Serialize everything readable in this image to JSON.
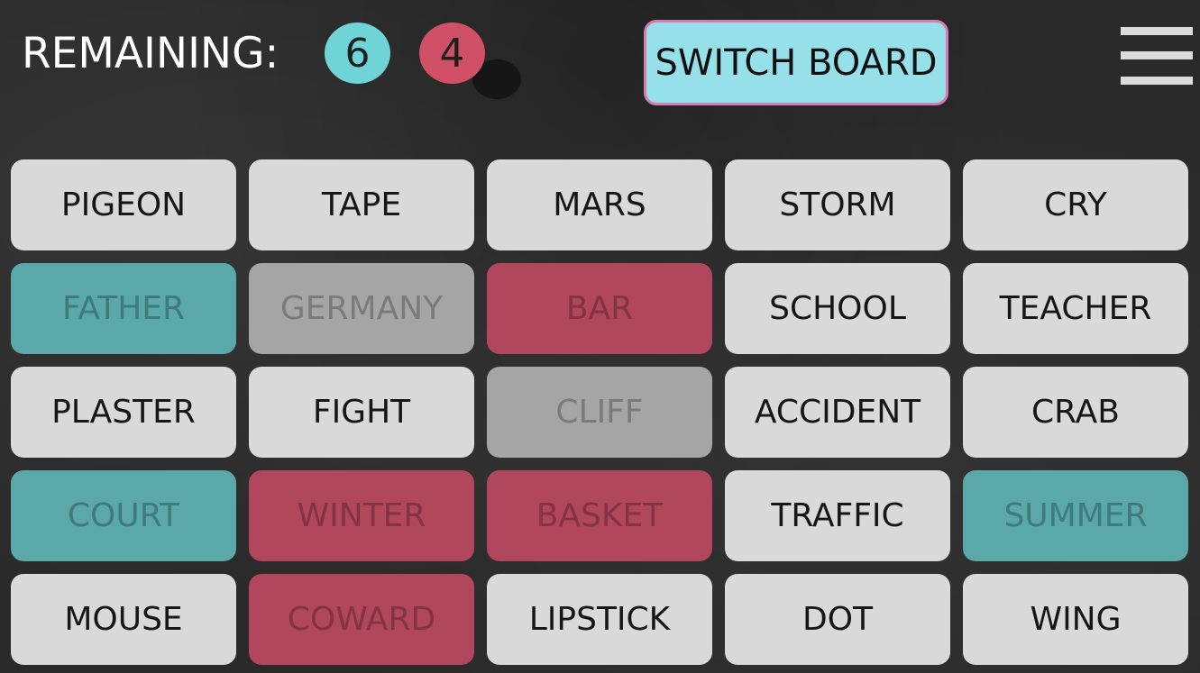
{
  "header": {
    "remaining_label": "REMAINING:",
    "teal_count": "6",
    "red_count": "4",
    "switch_board_label": "SWITCH BOARD"
  },
  "colors": {
    "teal": "#6fd4d6",
    "red": "#d05067",
    "switch_bg": "#96e0ea",
    "switch_border": "#d77bb3"
  },
  "board": {
    "cards": [
      {
        "word": "PIGEON",
        "state": "neutral"
      },
      {
        "word": "TAPE",
        "state": "neutral"
      },
      {
        "word": "MARS",
        "state": "neutral"
      },
      {
        "word": "STORM",
        "state": "neutral"
      },
      {
        "word": "CRY",
        "state": "neutral"
      },
      {
        "word": "FATHER",
        "state": "blue"
      },
      {
        "word": "GERMANY",
        "state": "bystander"
      },
      {
        "word": "BAR",
        "state": "red"
      },
      {
        "word": "SCHOOL",
        "state": "neutral"
      },
      {
        "word": "TEACHER",
        "state": "neutral"
      },
      {
        "word": "PLASTER",
        "state": "neutral"
      },
      {
        "word": "FIGHT",
        "state": "neutral"
      },
      {
        "word": "CLIFF",
        "state": "bystander"
      },
      {
        "word": "ACCIDENT",
        "state": "neutral"
      },
      {
        "word": "CRAB",
        "state": "neutral"
      },
      {
        "word": "COURT",
        "state": "blue"
      },
      {
        "word": "WINTER",
        "state": "red"
      },
      {
        "word": "BASKET",
        "state": "red"
      },
      {
        "word": "TRAFFIC",
        "state": "neutral"
      },
      {
        "word": "SUMMER",
        "state": "blue"
      },
      {
        "word": "MOUSE",
        "state": "neutral"
      },
      {
        "word": "COWARD",
        "state": "red"
      },
      {
        "word": "LIPSTICK",
        "state": "neutral"
      },
      {
        "word": "DOT",
        "state": "neutral"
      },
      {
        "word": "WING",
        "state": "neutral"
      }
    ]
  }
}
